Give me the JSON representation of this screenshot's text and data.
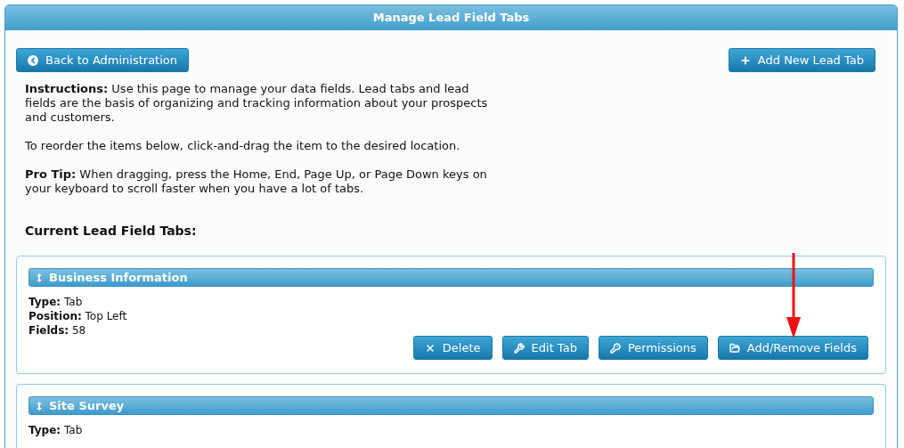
{
  "window": {
    "title": "Manage Lead Field Tabs"
  },
  "toolbar": {
    "back_button": "Back to Administration",
    "add_button": "Add New Lead Tab"
  },
  "instructions": [
    "**Instructions:** Use this page to manage your data fields. Lead tabs and lead fields are the basis of organizing and tracking information about your prospects and customers.",
    "To reorder the items below, click-and-drag the item to the desired location.",
    "**Pro Tip:** When dragging, press the Home, End, Page Up, or Page Down keys on your keyboard to scroll faster when you have a lot of tabs."
  ],
  "section_title": "Current Lead Field Tabs:",
  "tabs": [
    {
      "title": "Business Information",
      "fields": [
        {
          "label": "Type:",
          "value": "Tab"
        },
        {
          "label": "Position:",
          "value": "Top Left"
        },
        {
          "label": "Fields:",
          "value": "58"
        }
      ],
      "buttons": [
        {
          "kind": "delete",
          "label": "Delete"
        },
        {
          "kind": "edit",
          "label": "Edit Tab"
        },
        {
          "kind": "permissions",
          "label": "Permissions"
        },
        {
          "kind": "fields",
          "label": "Add/Remove Fields"
        }
      ]
    },
    {
      "title": "Site Survey",
      "fields": [
        {
          "label": "Type:",
          "value": "Tab"
        }
      ]
    }
  ]
}
